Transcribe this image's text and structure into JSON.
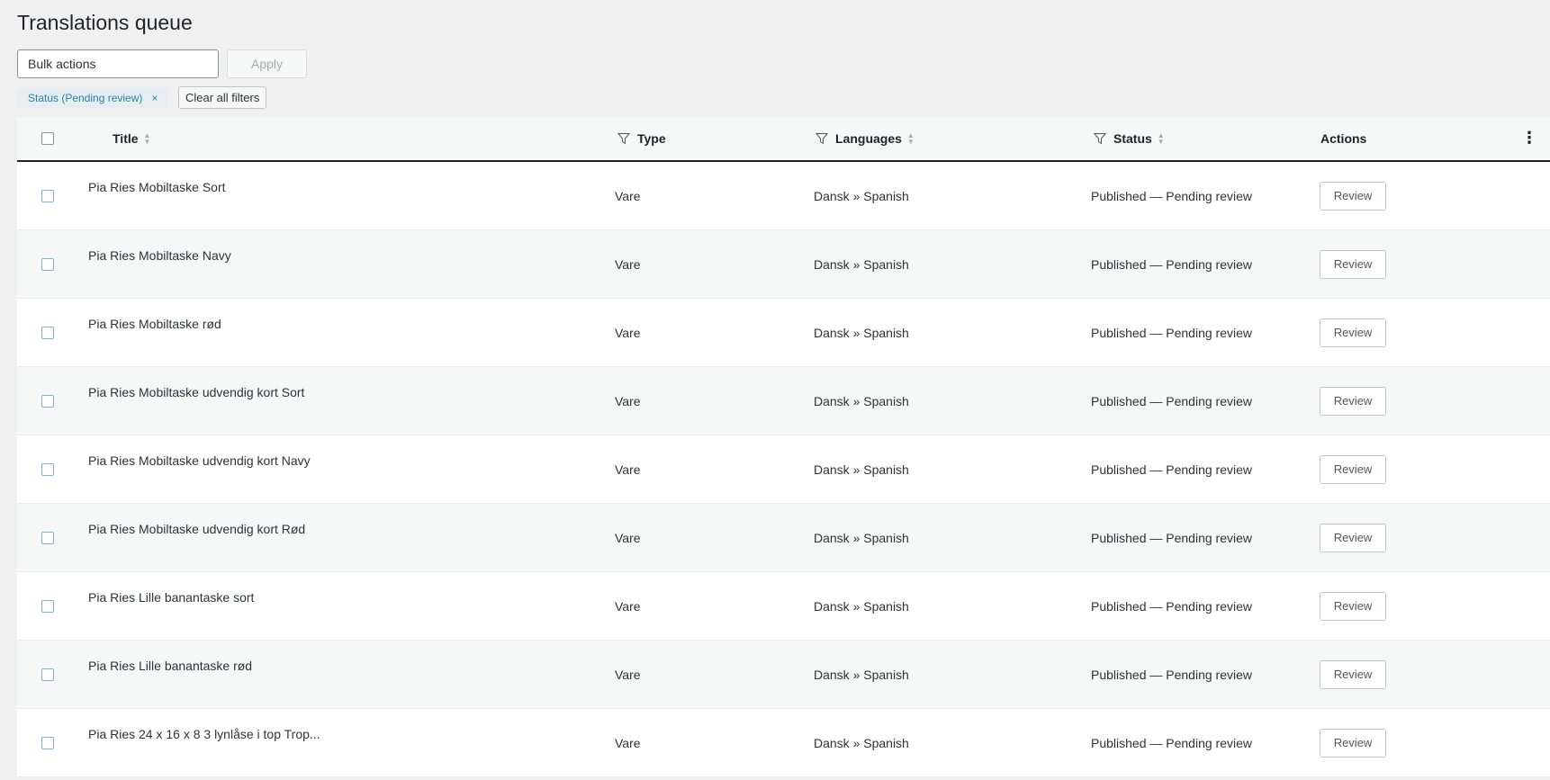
{
  "page": {
    "title": "Translations queue"
  },
  "toolbar": {
    "bulk_actions": "Bulk actions",
    "apply_label": "Apply"
  },
  "filters": {
    "active_chip": "Status (Pending review)",
    "chip_remove": "×",
    "clear_all": "Clear all filters"
  },
  "table": {
    "columns": {
      "title": "Title",
      "type": "Type",
      "languages": "Languages",
      "status": "Status",
      "actions": "Actions"
    },
    "more_icon": "⋮",
    "rows": [
      {
        "title": "Pia Ries Mobiltaske Sort",
        "type": "Vare",
        "languages": "Dansk » Spanish",
        "status": "Published — Pending review",
        "action": "Review"
      },
      {
        "title": "Pia Ries Mobiltaske Navy",
        "type": "Vare",
        "languages": "Dansk » Spanish",
        "status": "Published — Pending review",
        "action": "Review"
      },
      {
        "title": "Pia Ries Mobiltaske rød",
        "type": "Vare",
        "languages": "Dansk » Spanish",
        "status": "Published — Pending review",
        "action": "Review"
      },
      {
        "title": "Pia Ries Mobiltaske udvendig kort Sort",
        "type": "Vare",
        "languages": "Dansk » Spanish",
        "status": "Published — Pending review",
        "action": "Review"
      },
      {
        "title": "Pia Ries Mobiltaske udvendig kort Navy",
        "type": "Vare",
        "languages": "Dansk » Spanish",
        "status": "Published — Pending review",
        "action": "Review"
      },
      {
        "title": "Pia Ries Mobiltaske udvendig kort Rød",
        "type": "Vare",
        "languages": "Dansk » Spanish",
        "status": "Published — Pending review",
        "action": "Review"
      },
      {
        "title": "Pia Ries Lille banantaske sort",
        "type": "Vare",
        "languages": "Dansk » Spanish",
        "status": "Published — Pending review",
        "action": "Review"
      },
      {
        "title": "Pia Ries Lille banantaske rød",
        "type": "Vare",
        "languages": "Dansk » Spanish",
        "status": "Published — Pending review",
        "action": "Review"
      },
      {
        "title": "Pia Ries 24 x 16 x 8 3 lynlåse i top Trop...",
        "type": "Vare",
        "languages": "Dansk » Spanish",
        "status": "Published — Pending review",
        "action": "Review"
      }
    ]
  },
  "colors": {
    "background": "#f0f0f1",
    "chip_text": "#2a7fa5",
    "chip_bg": "#e6eef3",
    "header_border": "#1d2327"
  }
}
